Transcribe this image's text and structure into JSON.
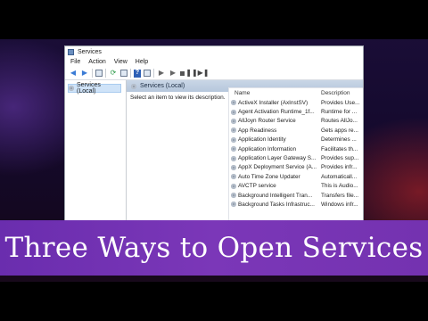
{
  "window": {
    "title": "Services",
    "menu": [
      "File",
      "Action",
      "View",
      "Help"
    ],
    "toolbar_icons": [
      "back-icon",
      "forward-icon",
      "console-tree-icon",
      "refresh-icon",
      "export-icon",
      "help-icon",
      "properties-icon",
      "start-icon",
      "start-alt-icon",
      "stop-icon",
      "pause-icon",
      "restart-icon"
    ]
  },
  "tree": {
    "selected_item": "Services (Local)"
  },
  "main": {
    "header": "Services (Local)",
    "description": "Select an item to view its description.",
    "columns": {
      "name": "Name",
      "description": "Description"
    },
    "rows": [
      {
        "name": "ActiveX Installer (AxInstSV)",
        "description": "Provides Use..."
      },
      {
        "name": "Agent Activation Runtime_1f...",
        "description": "Runtime for ..."
      },
      {
        "name": "AllJoyn Router Service",
        "description": "Routes AllJo..."
      },
      {
        "name": "App Readiness",
        "description": "Gets apps re..."
      },
      {
        "name": "Application Identity",
        "description": "Determines ..."
      },
      {
        "name": "Application Information",
        "description": "Facilitates th..."
      },
      {
        "name": "Application Layer Gateway S...",
        "description": "Provides sup..."
      },
      {
        "name": "AppX Deployment Service (A...",
        "description": "Provides infr..."
      },
      {
        "name": "Auto Time Zone Updater",
        "description": "Automaticall..."
      },
      {
        "name": "AVCTP service",
        "description": "This is Audio..."
      },
      {
        "name": "Background Intelligent Tran...",
        "description": "Transfers file..."
      },
      {
        "name": "Background Tasks Infrastruc...",
        "description": "Windows infr..."
      }
    ]
  },
  "banner": {
    "text": "Three Ways to Open Services"
  },
  "colors": {
    "banner": "#6f31b3",
    "header_bar": "#bccbe0",
    "selection": "#cfe3f8"
  }
}
